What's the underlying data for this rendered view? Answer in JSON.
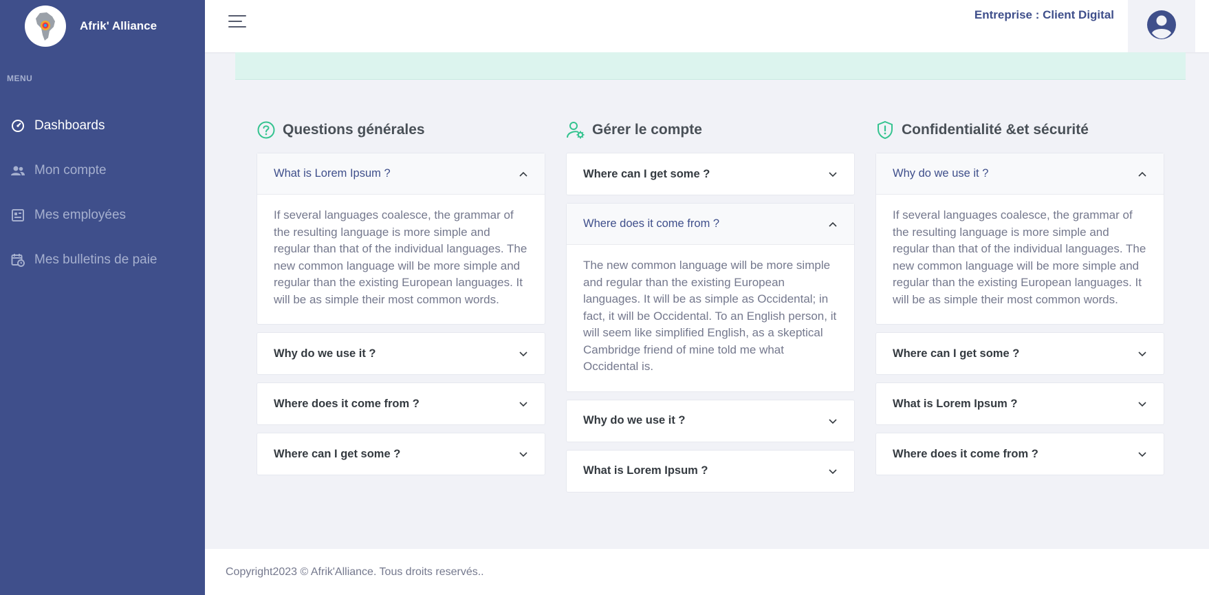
{
  "brand": {
    "name": "Afrik' Alliance",
    "logo_icon": "africa-map-logo"
  },
  "sidebar": {
    "menu_title": "MENU",
    "items": [
      {
        "label": "Dashboards",
        "icon": "speedometer-icon",
        "active": true
      },
      {
        "label": "Mon compte",
        "icon": "users-icon",
        "active": false
      },
      {
        "label": "Mes employées",
        "icon": "list-document-icon",
        "active": false
      },
      {
        "label": "Mes bulletins de paie",
        "icon": "calendar-clock-icon",
        "active": false
      }
    ]
  },
  "topbar": {
    "company": "Entreprise : Client Digital",
    "user_icon": "user-circle-icon"
  },
  "colors": {
    "sidebar": "#3f4f8b",
    "accent": "#34c38f",
    "alert": "#dcf4ee"
  },
  "faq": {
    "columns": [
      {
        "title": "Questions générales",
        "icon": "question-circle-icon",
        "items": [
          {
            "q": "What is Lorem Ipsum ?",
            "open": true,
            "a": "If several languages coalesce, the grammar of the resulting language is more simple and regular than that of the individual languages. The new common language will be more simple and regular than the existing European languages. It will be as simple their most common words."
          },
          {
            "q": "Why do we use it ?",
            "open": false
          },
          {
            "q": "Where does it come from ?",
            "open": false
          },
          {
            "q": "Where can I get some ?",
            "open": false
          }
        ]
      },
      {
        "title": "Gérer le compte",
        "icon": "user-settings-icon",
        "items": [
          {
            "q": "Where can I get some ?",
            "open": false
          },
          {
            "q": "Where does it come from ?",
            "open": true,
            "a": "The new common language will be more simple and regular than the existing European languages. It will be as simple as Occidental; in fact, it will be Occidental. To an English person, it will seem like simplified English, as a skeptical Cambridge friend of mine told me what Occidental is."
          },
          {
            "q": "Why do we use it ?",
            "open": false
          },
          {
            "q": "What is Lorem Ipsum ?",
            "open": false
          }
        ]
      },
      {
        "title": "Confidentialité &et sécurité",
        "icon": "shield-alert-icon",
        "items": [
          {
            "q": "Why do we use it ?",
            "open": true,
            "a": "If several languages coalesce, the grammar of the resulting language is more simple and regular than that of the individual languages. The new common language will be more simple and regular than the existing European languages. It will be as simple their most common words."
          },
          {
            "q": "Where can I get some ?",
            "open": false
          },
          {
            "q": "What is Lorem Ipsum ?",
            "open": false
          },
          {
            "q": "Where does it come from ?",
            "open": false
          }
        ]
      }
    ]
  },
  "footer": {
    "text": "Copyright2023 © Afrik'Alliance. Tous droits reservés.."
  }
}
